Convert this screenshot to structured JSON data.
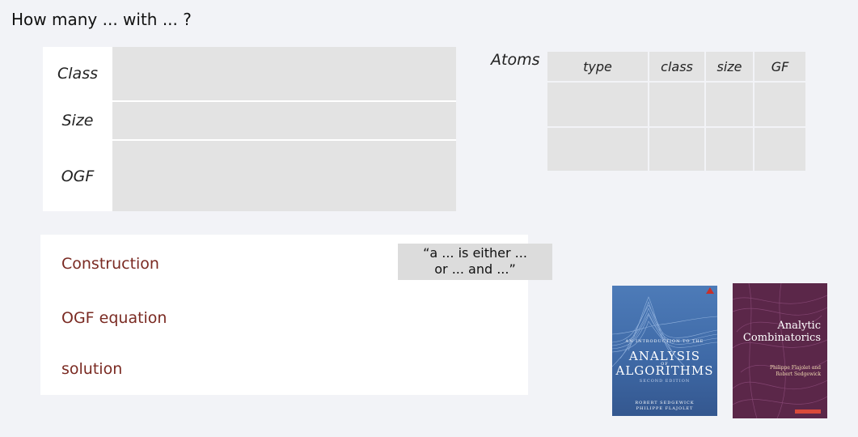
{
  "title": "How many ... with ... ?",
  "definition_table": {
    "rows": [
      {
        "label": "Class",
        "value": ""
      },
      {
        "label": "Size",
        "value": ""
      },
      {
        "label": "OGF",
        "value": ""
      }
    ]
  },
  "atoms": {
    "label": "Atoms",
    "headers": [
      "type",
      "class",
      "size",
      "GF"
    ],
    "rows": [
      [
        "",
        "",
        "",
        ""
      ],
      [
        "",
        "",
        "",
        ""
      ]
    ]
  },
  "construction_panel": {
    "rows": [
      "Construction",
      "OGF equation",
      "solution"
    ],
    "quote_line1": "“a  ... is either ...",
    "quote_line2": "or ...  and ...”"
  },
  "books": {
    "book1": {
      "overline": "AN INTRODUCTION TO THE",
      "title_line1": "ANALYSIS",
      "of": "OF",
      "title_line2": "ALGORITHMS",
      "edition": "SECOND EDITION",
      "author1": "ROBERT SEDGEWICK",
      "author2": "PHILIPPE FLAJOLET"
    },
    "book2": {
      "title_line1": "Analytic",
      "title_line2": "Combinatorics",
      "author1": "Philippe Flajolet and",
      "author2": "Robert Sedgewick"
    }
  },
  "colors": {
    "accent_text": "#7a2a22",
    "cell_fill": "#e3e3e3",
    "background": "#f2f3f7"
  }
}
